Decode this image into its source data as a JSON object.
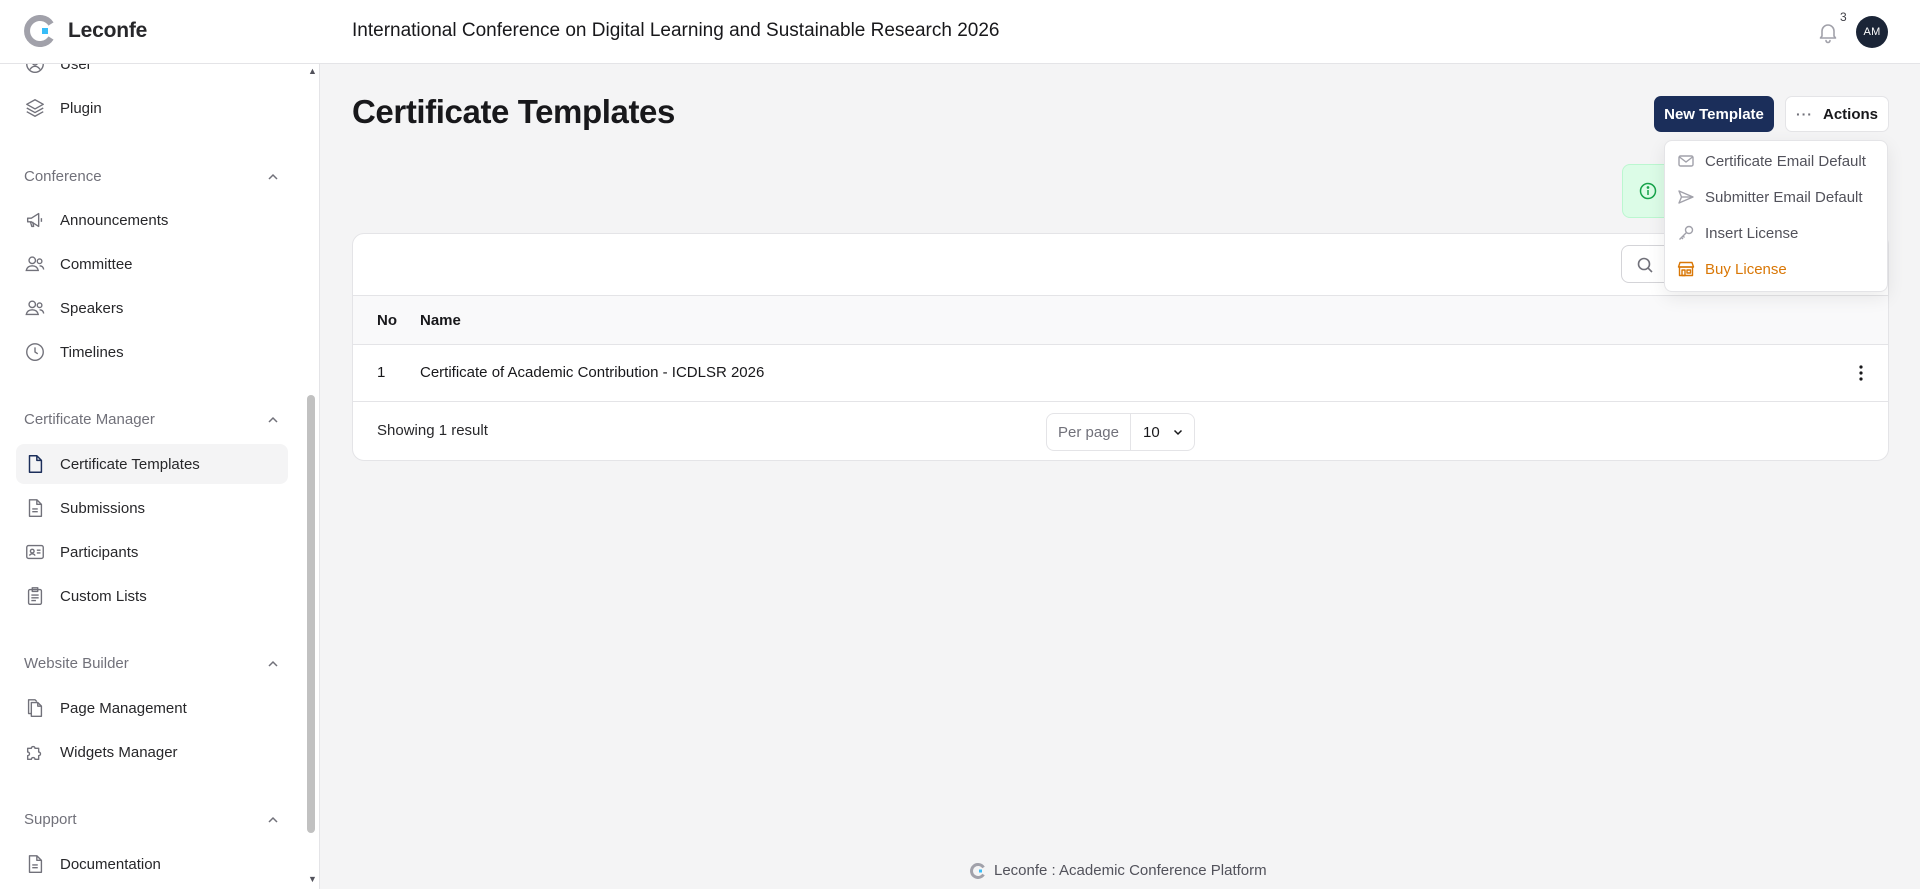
{
  "app": {
    "name": "Leconfe"
  },
  "header": {
    "conference_title": "International Conference on Digital Learning and Sustainable Research 2026",
    "notification_count": "3",
    "avatar_initials": "AM"
  },
  "sidebar": {
    "top_items": [
      {
        "label": "User",
        "icon": "user-icon"
      },
      {
        "label": "Plugin",
        "icon": "layers-icon"
      }
    ],
    "groups": [
      {
        "title": "Conference",
        "items": [
          {
            "label": "Announcements",
            "icon": "megaphone-icon"
          },
          {
            "label": "Committee",
            "icon": "users-icon"
          },
          {
            "label": "Speakers",
            "icon": "users-icon"
          },
          {
            "label": "Timelines",
            "icon": "clock-icon"
          }
        ]
      },
      {
        "title": "Certificate Manager",
        "items": [
          {
            "label": "Certificate Templates",
            "icon": "document-icon",
            "active": true
          },
          {
            "label": "Submissions",
            "icon": "document-text-icon"
          },
          {
            "label": "Participants",
            "icon": "id-card-icon"
          },
          {
            "label": "Custom Lists",
            "icon": "clipboard-list-icon"
          }
        ]
      },
      {
        "title": "Website Builder",
        "items": [
          {
            "label": "Page Management",
            "icon": "documents-icon"
          },
          {
            "label": "Widgets Manager",
            "icon": "puzzle-icon"
          }
        ]
      },
      {
        "title": "Support",
        "items": [
          {
            "label": "Documentation",
            "icon": "document-text-icon"
          }
        ]
      }
    ]
  },
  "main": {
    "page_title": "Certificate Templates",
    "new_button": "New Template",
    "actions_button": "Actions",
    "actions_menu": [
      {
        "label": "Certificate Email Default",
        "icon": "envelope-icon"
      },
      {
        "label": "Submitter Email Default",
        "icon": "paper-airplane-icon"
      },
      {
        "label": "Insert License",
        "icon": "key-icon"
      },
      {
        "label": "Buy License",
        "icon": "shop-icon",
        "color": "#d97706"
      }
    ],
    "table": {
      "columns": [
        "No",
        "Name"
      ],
      "rows": [
        {
          "no": "1",
          "name": "Certificate of Academic Contribution - ICDLSR 2026"
        }
      ],
      "summary": "Showing 1 result",
      "per_page_label": "Per page",
      "per_page_value": "10"
    }
  },
  "footer": {
    "text": "Leconfe : Academic Conference Platform"
  },
  "colors": {
    "primary": "#1b2e5a",
    "warning": "#d97706",
    "success_bg": "#dcfce7",
    "success": "#16a34a"
  }
}
